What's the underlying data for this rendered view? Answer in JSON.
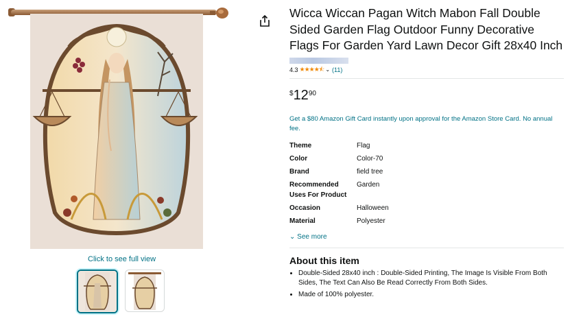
{
  "product": {
    "title": "Wicca Wiccan Pagan Witch Mabon Fall Double Sided Garden Flag Outdoor Funny Decorative Flags For Garden Yard Lawn Decor Gift 28x40 Inch",
    "rating_value": "4.3",
    "stars": "★★★★⯪",
    "review_count": "(11)",
    "price_symbol": "$",
    "price_whole": "12",
    "price_fraction": "90",
    "promo": "Get a $80 Amazon Gift Card instantly upon approval for the Amazon Store Card. No annual fee."
  },
  "gallery": {
    "full_view_label": "Click to see full view",
    "main_image_icon": "goddess-flag-image",
    "thumbnails": [
      "flag-front-thumbnail",
      "flag-back-thumbnail"
    ]
  },
  "icons": {
    "share": "share-icon"
  },
  "specs": [
    {
      "key": "Theme",
      "value": "Flag"
    },
    {
      "key": "Color",
      "value": "Color-70"
    },
    {
      "key": "Brand",
      "value": "field tree"
    },
    {
      "key": "Recommended Uses For Product",
      "value": "Garden"
    },
    {
      "key": "Occasion",
      "value": "Halloween"
    },
    {
      "key": "Material",
      "value": "Polyester"
    }
  ],
  "see_more_label": "See more",
  "about": {
    "heading": "About this item",
    "bullets": [
      "Double-Sided 28x40 inch : Double-Sided Printing, The Image Is Visible From Both Sides, The Text Can Also Be Read Correctly From Both Sides.",
      "Made of 100% polyester."
    ]
  },
  "colors": {
    "link": "#007185",
    "star": "#f08804",
    "text": "#0f1111"
  }
}
